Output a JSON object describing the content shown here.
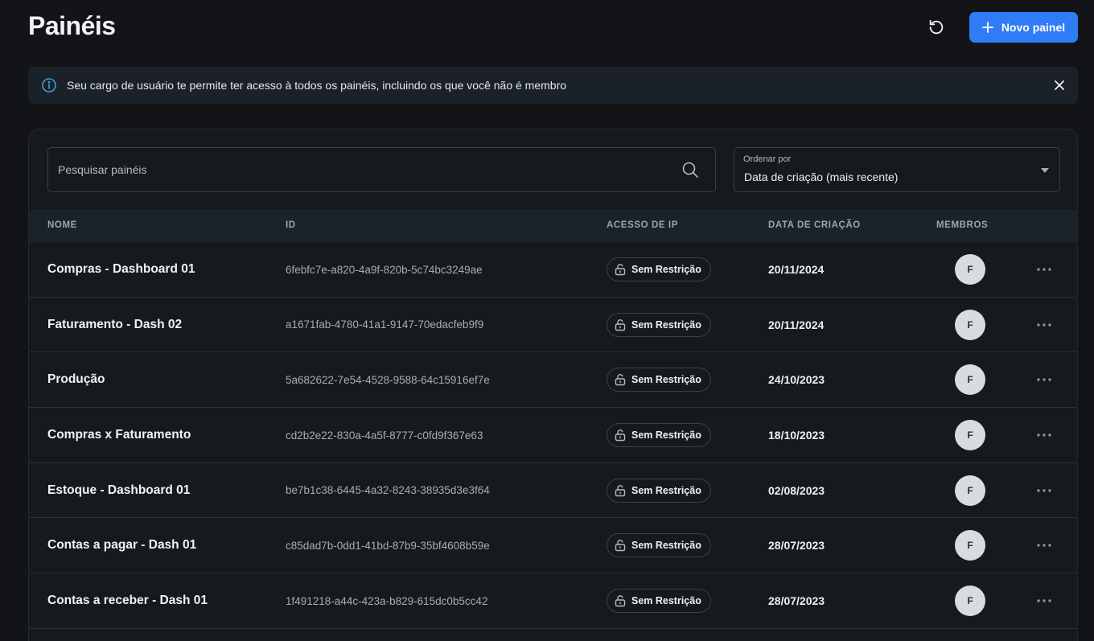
{
  "header": {
    "title": "Painéis",
    "new_panel_label": "Novo painel"
  },
  "banner": {
    "text": "Seu cargo de usuário te permite ter acesso à todos os painéis, incluindo os que você não é membro"
  },
  "search": {
    "placeholder": "Pesquisar painéis",
    "value": ""
  },
  "sort": {
    "label": "Ordenar por",
    "value": "Data de criação (mais recente)"
  },
  "table": {
    "columns": [
      "NOME",
      "ID",
      "ACESSO DE IP",
      "DATA DE CRIAÇÃO",
      "MEMBROS"
    ],
    "rows": [
      {
        "name": "Compras - Dashboard 01",
        "id": "6febfc7e-a820-4a9f-820b-5c74bc3249ae",
        "ip_access": "Sem Restrição",
        "created": "20/11/2024",
        "member": "F"
      },
      {
        "name": "Faturamento - Dash 02",
        "id": "a1671fab-4780-41a1-9147-70edacfeb9f9",
        "ip_access": "Sem Restrição",
        "created": "20/11/2024",
        "member": "F"
      },
      {
        "name": "Produção",
        "id": "5a682622-7e54-4528-9588-64c15916ef7e",
        "ip_access": "Sem Restrição",
        "created": "24/10/2023",
        "member": "F"
      },
      {
        "name": "Compras x Faturamento",
        "id": "cd2b2e22-830a-4a5f-8777-c0fd9f367e63",
        "ip_access": "Sem Restrição",
        "created": "18/10/2023",
        "member": "F"
      },
      {
        "name": "Estoque - Dashboard 01",
        "id": "be7b1c38-6445-4a32-8243-38935d3e3f64",
        "ip_access": "Sem Restrição",
        "created": "02/08/2023",
        "member": "F"
      },
      {
        "name": "Contas a pagar - Dash 01",
        "id": "c85dad7b-0dd1-41bd-87b9-35bf4608b59e",
        "ip_access": "Sem Restrição",
        "created": "28/07/2023",
        "member": "F"
      },
      {
        "name": "Contas a receber - Dash 01",
        "id": "1f491218-a44c-423a-b829-615dc0b5cc42",
        "ip_access": "Sem Restrição",
        "created": "28/07/2023",
        "member": "F"
      }
    ]
  },
  "colors": {
    "background": "#121417",
    "accent": "#2f7cf6",
    "info": "#3aa0e0"
  }
}
